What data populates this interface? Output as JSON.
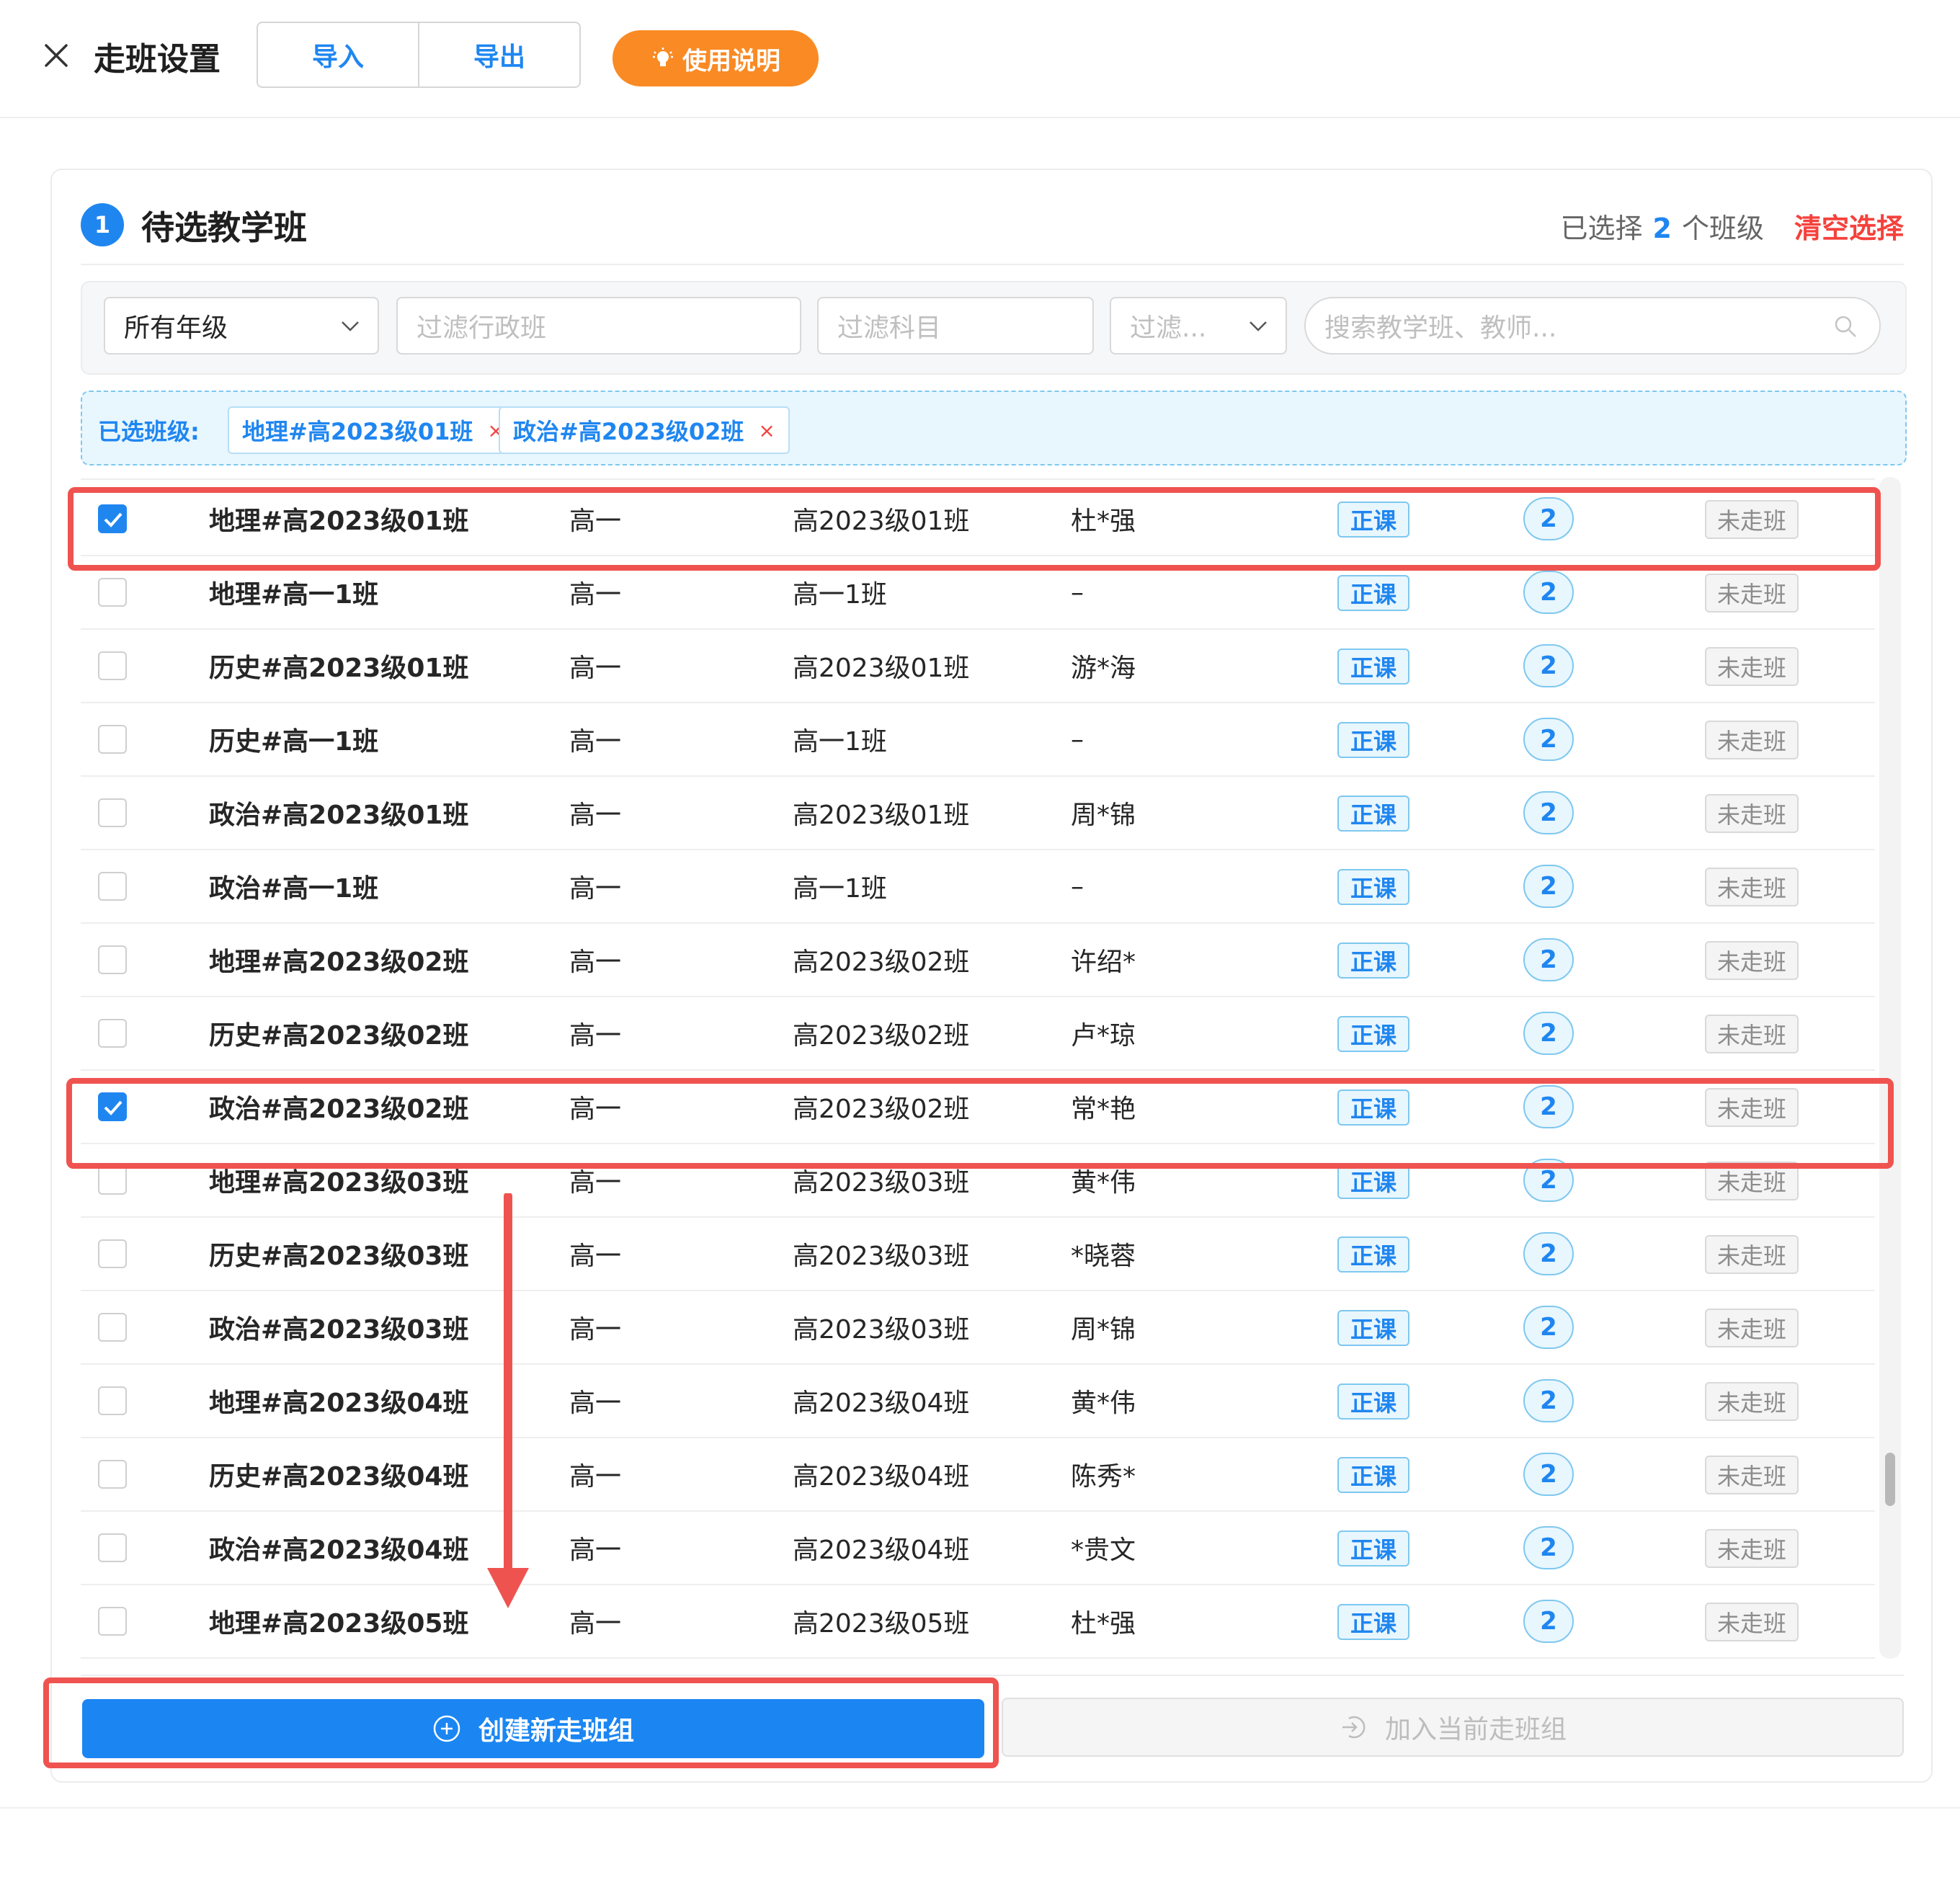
{
  "header": {
    "title": "走班设置",
    "import_label": "导入",
    "export_label": "导出",
    "help_label": "使用说明"
  },
  "section": {
    "step": "1",
    "title": "待选教学班",
    "selected_prefix": "已选择",
    "selected_count": "2",
    "selected_suffix": "个班级",
    "clear_label": "清空选择"
  },
  "filters": {
    "grade_value": "所有年级",
    "admin_class_placeholder": "过滤行政班",
    "subject_placeholder": "过滤科目",
    "type_placeholder": "过滤...",
    "search_placeholder": "搜索教学班、教师..."
  },
  "selected_tags": {
    "label": "已选班级:",
    "tags": [
      "地理#高2023级01班",
      "政治#高2023级02班"
    ],
    "remove_glyph": "×"
  },
  "rows": [
    {
      "checked": true,
      "name": "地理#高2023级01班",
      "grade": "高一",
      "admin_class": "高2023级01班",
      "teacher": "杜*强",
      "type": "正课",
      "count": "2",
      "status": "未走班"
    },
    {
      "checked": false,
      "name": "地理#高一1班",
      "grade": "高一",
      "admin_class": "高一1班",
      "teacher": "–",
      "type": "正课",
      "count": "2",
      "status": "未走班"
    },
    {
      "checked": false,
      "name": "历史#高2023级01班",
      "grade": "高一",
      "admin_class": "高2023级01班",
      "teacher": "游*海",
      "type": "正课",
      "count": "2",
      "status": "未走班"
    },
    {
      "checked": false,
      "name": "历史#高一1班",
      "grade": "高一",
      "admin_class": "高一1班",
      "teacher": "–",
      "type": "正课",
      "count": "2",
      "status": "未走班"
    },
    {
      "checked": false,
      "name": "政治#高2023级01班",
      "grade": "高一",
      "admin_class": "高2023级01班",
      "teacher": "周*锦",
      "type": "正课",
      "count": "2",
      "status": "未走班"
    },
    {
      "checked": false,
      "name": "政治#高一1班",
      "grade": "高一",
      "admin_class": "高一1班",
      "teacher": "–",
      "type": "正课",
      "count": "2",
      "status": "未走班"
    },
    {
      "checked": false,
      "name": "地理#高2023级02班",
      "grade": "高一",
      "admin_class": "高2023级02班",
      "teacher": "许绍*",
      "type": "正课",
      "count": "2",
      "status": "未走班"
    },
    {
      "checked": false,
      "name": "历史#高2023级02班",
      "grade": "高一",
      "admin_class": "高2023级02班",
      "teacher": "卢*琼",
      "type": "正课",
      "count": "2",
      "status": "未走班"
    },
    {
      "checked": true,
      "name": "政治#高2023级02班",
      "grade": "高一",
      "admin_class": "高2023级02班",
      "teacher": "常*艳",
      "type": "正课",
      "count": "2",
      "status": "未走班"
    },
    {
      "checked": false,
      "name": "地理#高2023级03班",
      "grade": "高一",
      "admin_class": "高2023级03班",
      "teacher": "黄*伟",
      "type": "正课",
      "count": "2",
      "status": "未走班"
    },
    {
      "checked": false,
      "name": "历史#高2023级03班",
      "grade": "高一",
      "admin_class": "高2023级03班",
      "teacher": "*晓蓉",
      "type": "正课",
      "count": "2",
      "status": "未走班"
    },
    {
      "checked": false,
      "name": "政治#高2023级03班",
      "grade": "高一",
      "admin_class": "高2023级03班",
      "teacher": "周*锦",
      "type": "正课",
      "count": "2",
      "status": "未走班"
    },
    {
      "checked": false,
      "name": "地理#高2023级04班",
      "grade": "高一",
      "admin_class": "高2023级04班",
      "teacher": "黄*伟",
      "type": "正课",
      "count": "2",
      "status": "未走班"
    },
    {
      "checked": false,
      "name": "历史#高2023级04班",
      "grade": "高一",
      "admin_class": "高2023级04班",
      "teacher": "陈秀*",
      "type": "正课",
      "count": "2",
      "status": "未走班"
    },
    {
      "checked": false,
      "name": "政治#高2023级04班",
      "grade": "高一",
      "admin_class": "高2023级04班",
      "teacher": "*贵文",
      "type": "正课",
      "count": "2",
      "status": "未走班"
    },
    {
      "checked": false,
      "name": "地理#高2023级05班",
      "grade": "高一",
      "admin_class": "高2023级05班",
      "teacher": "杜*强",
      "type": "正课",
      "count": "2",
      "status": "未走班"
    }
  ],
  "actions": {
    "create_label": "创建新走班组",
    "join_label": "加入当前走班组"
  },
  "colors": {
    "primary": "#1f86f0",
    "orange": "#fa8a23",
    "danger": "#f5413c",
    "annotation": "#ef5350"
  }
}
